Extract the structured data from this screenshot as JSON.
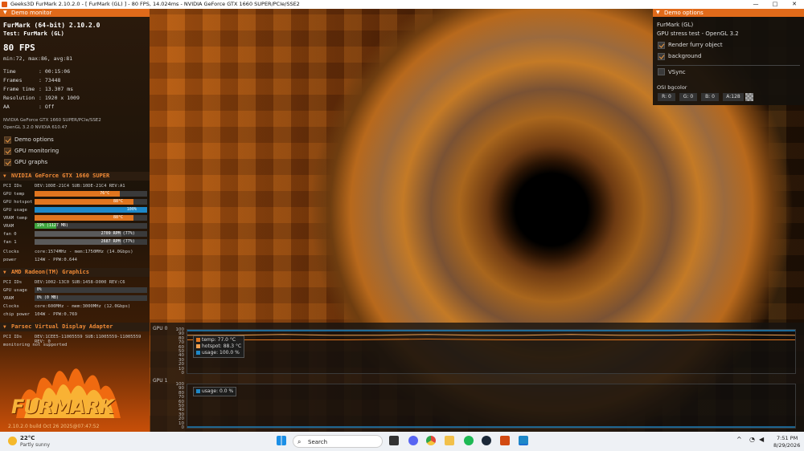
{
  "window": {
    "title": "Geeks3D FurMark 2.10.2.0 - [ FurMark (GL) ] - 80 FPS, 14.024ms - NVIDIA GeForce GTX 1660 SUPER/PCIe/SSE2",
    "minimize": "—",
    "maximize": "□",
    "close": "✕"
  },
  "demo_monitor": {
    "header": "Demo monitor",
    "app": "FurMark (64-bit) 2.10.2.0",
    "test": "Test: FurMark (GL)",
    "fps": "80 FPS",
    "fps_stats": "min:72, max:86, avg:81",
    "stats": [
      {
        "label": "Time",
        "value": ": 00:15:06"
      },
      {
        "label": "Frames",
        "value": ": 73448"
      },
      {
        "label": "Frame time",
        "value": ": 13.307 ms"
      },
      {
        "label": "Resolution",
        "value": ": 1920 x 1009"
      },
      {
        "label": "AA",
        "value": ": Off"
      }
    ],
    "gpu_line": "NVIDIA GeForce GTX 1660 SUPER/PCIe/SSE2",
    "gl_line": "OpenGL 3.2.0 NVIDIA 610.47",
    "options": [
      "Demo options",
      "GPU monitoring",
      "GPU graphs"
    ]
  },
  "nvidia": {
    "header": "NVIDIA GeForce GTX 1660 SUPER",
    "pci_label": "PCI IDs",
    "pci": "DEV:10DE-21C4 SUB:10DE-21C4 REV:A1",
    "rows": [
      {
        "label": "GPU temp",
        "value": "76°C",
        "fill": 0.76,
        "color": "#e0751f"
      },
      {
        "label": "GPU hotspot",
        "value": "88°C",
        "fill": 0.88,
        "color": "#e0751f"
      },
      {
        "label": "GPU usage",
        "value": "100%",
        "fill": 1.0,
        "color": "#1e88c8"
      },
      {
        "label": "VRAM temp",
        "value": "88°C",
        "fill": 0.88,
        "color": "#e0751f"
      },
      {
        "label": "VRAM",
        "value": "19% (1127 MB)",
        "fill": 0.19,
        "color": "#3ea53e"
      },
      {
        "label": "fan 0",
        "value": "2709 RPM (77%)",
        "fill": 0.77,
        "color": "#5a5a5a"
      },
      {
        "label": "fan 1",
        "value": "2687 RPM (77%)",
        "fill": 0.77,
        "color": "#5a5a5a"
      }
    ],
    "clocks_label": "Clocks",
    "clocks": "core:1574MHz - mem:1750MHz (14.0Gbps)",
    "power_label": "power",
    "power": "124W - PPW:0.644"
  },
  "amd": {
    "header": "AMD Radeon(TM) Graphics",
    "pci_label": "PCI IDs",
    "pci": "DEV:1002-13C0 SUB:1458-D000 REV:C6",
    "rows": [
      {
        "label": "GPU usage",
        "value": "0%",
        "fill": 0.0,
        "color": "#1e88c8"
      },
      {
        "label": "VRAM",
        "value": "0% (0 MB)",
        "fill": 0.0,
        "color": "#3ea53e"
      }
    ],
    "clocks_label": "Clocks",
    "clocks": "core:600MHz - mem:3000MHz (12.0Gbps)",
    "power_label": "chip power",
    "power": "104W - PPW:0.769"
  },
  "parsec": {
    "header": "Parsec Virtual Display Adapter",
    "pci_label": "PCI IDs",
    "pci": "DEV:1CEE5-11005559 SUB:11005559-11005559 REV: 0",
    "note": "monitoring not supported"
  },
  "logo_text": "FURMARK",
  "build": "2.10.2.0 build Oct 26 2025@07:47:52",
  "demo_options": {
    "header": "Demo options",
    "app": "FurMark (GL)",
    "subtitle": "GPU stress test - OpenGL 3.2",
    "checks": [
      {
        "label": "Render furry object",
        "checked": true
      },
      {
        "label": "background",
        "checked": true
      },
      {
        "label": "VSync",
        "checked": false
      }
    ],
    "bgcolor_label": "OSI bgcolor",
    "rgba": [
      "R: 0",
      "G: 0",
      "B: 0",
      "A:128"
    ]
  },
  "graphs": {
    "gpu0": {
      "label": "GPU 0",
      "ticks": [
        "100",
        "90",
        "80",
        "70",
        "60",
        "50",
        "40",
        "30",
        "20",
        "10",
        "0"
      ],
      "legend": [
        {
          "label": "temp: 77.0 °C",
          "color": "#e0751f"
        },
        {
          "label": "hotspot: 88.3 °C",
          "color": "#f0a050"
        },
        {
          "label": "usage: 100.0 %",
          "color": "#1e88c8"
        }
      ]
    },
    "gpu1": {
      "label": "GPU 1",
      "ticks": [
        "100",
        "90",
        "80",
        "70",
        "60",
        "50",
        "40",
        "30",
        "20",
        "10",
        "0"
      ],
      "legend": [
        {
          "label": "usage: 0.0 %",
          "color": "#1e88c8"
        }
      ]
    }
  },
  "taskbar": {
    "weather_temp": "22°C",
    "weather_desc": "Partly sunny",
    "search_placeholder": "Search",
    "time": "7:51 PM",
    "date": "8/29/2026",
    "icons": [
      {
        "name": "windows-start",
        "color": "#1b8fe6"
      },
      {
        "name": "task-view",
        "color": "#333"
      },
      {
        "name": "file-explorer",
        "color": "#f2c04a"
      },
      {
        "name": "discord",
        "color": "#5865f2"
      },
      {
        "name": "chrome",
        "color": "#e0463a"
      },
      {
        "name": "spotify",
        "color": "#1db954"
      },
      {
        "name": "steam",
        "color": "#1b2838"
      },
      {
        "name": "furmark",
        "color": "#d24a12"
      },
      {
        "name": "app-window",
        "color": "#1e88c8"
      }
    ]
  }
}
